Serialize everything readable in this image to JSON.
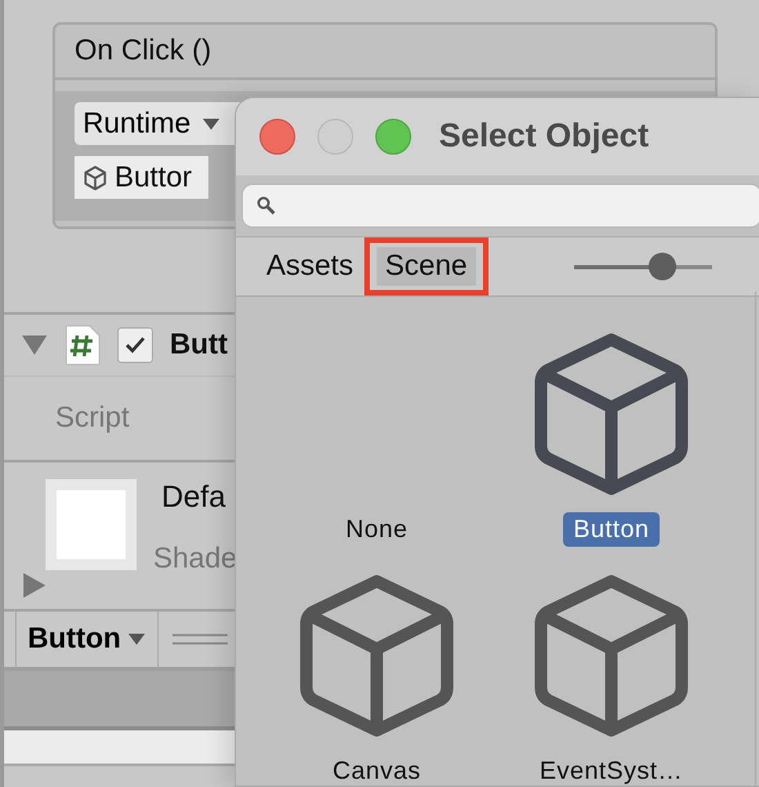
{
  "inspector": {
    "event": {
      "title": "On Click ()",
      "runtime": "Runtime",
      "object": "Buttor"
    },
    "component": {
      "expanded": true,
      "enabled": true,
      "name": "Butt",
      "script_label": "Script"
    },
    "material": {
      "expanded": false,
      "name": "Defa",
      "shader": "Shade"
    },
    "footer": {
      "dropdown": "Button"
    }
  },
  "dialog": {
    "title": "Select Object",
    "tabs": [
      {
        "label": "Assets",
        "selected": false
      },
      {
        "label": "Scene",
        "selected": true,
        "highlighted": true
      }
    ],
    "size_slider": {
      "level": 0.64
    },
    "items": [
      {
        "label": "None",
        "kind": "none",
        "selected": false
      },
      {
        "label": "Button",
        "kind": "object",
        "selected": true
      },
      {
        "label": "Canvas",
        "kind": "object",
        "selected": false
      },
      {
        "label": "EventSyst…",
        "kind": "object",
        "selected": false
      }
    ]
  }
}
